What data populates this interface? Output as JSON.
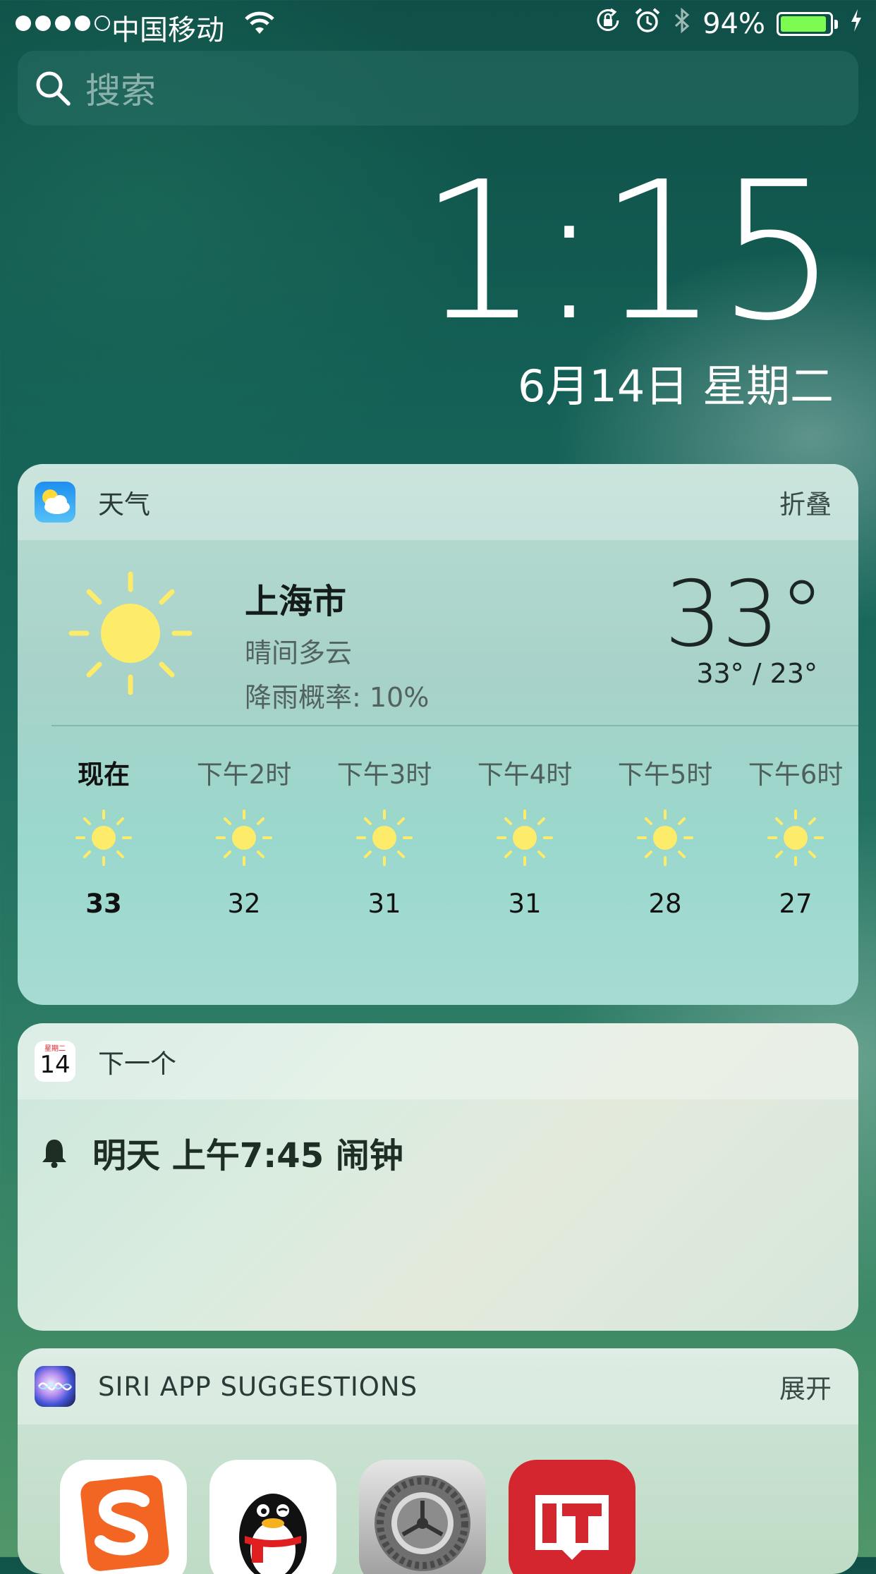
{
  "status_bar": {
    "carrier": "中国移动",
    "battery": "94%",
    "battery_level": 0.94,
    "icons": [
      "signal-dots-icon",
      "wifi-icon",
      "orientation-lock-icon",
      "alarm-icon",
      "bluetooth-icon",
      "battery-icon",
      "charging-icon"
    ]
  },
  "search": {
    "placeholder": "搜索"
  },
  "lock": {
    "time": "1:15",
    "date": "6月14日 星期二"
  },
  "weather_widget": {
    "title": "天气",
    "action": "折叠",
    "city": "上海市",
    "condition": "晴间多云",
    "rain_chance": "降雨概率: 10%",
    "current_temp": "33°",
    "range": "33° / 23°",
    "hourly": [
      {
        "label": "现在",
        "temp": "33"
      },
      {
        "label": "下午2时",
        "temp": "32"
      },
      {
        "label": "下午3时",
        "temp": "31"
      },
      {
        "label": "下午4时",
        "temp": "31"
      },
      {
        "label": "下午5时",
        "temp": "28"
      },
      {
        "label": "下午6时",
        "temp": "27"
      }
    ],
    "sun_color": "#FDEB6A"
  },
  "calendar_widget": {
    "title": "下一个",
    "icon_weekday": "星期二",
    "icon_day": "14",
    "event": "明天 上午7:45 闹钟"
  },
  "siri_widget": {
    "title": "SIRI APP SUGGESTIONS",
    "action": "展开",
    "apps": [
      "sogou-input-app-icon",
      "qq-app-icon",
      "settings-app-icon",
      "ithome-app-icon"
    ]
  }
}
